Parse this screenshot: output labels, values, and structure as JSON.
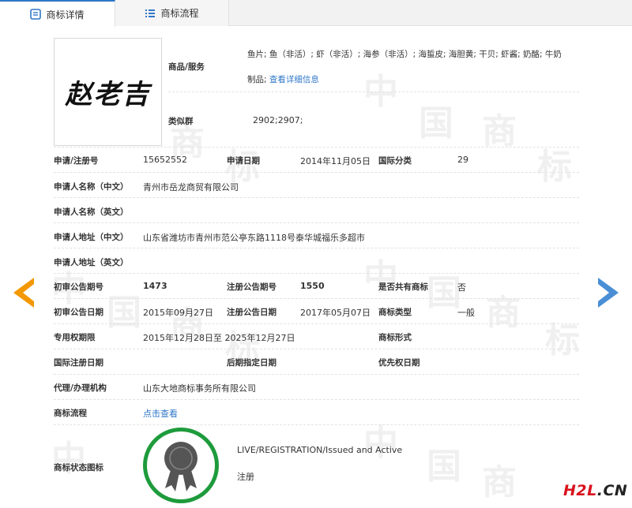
{
  "tabs": [
    {
      "label": "商标详情",
      "icon": "document-icon",
      "active": true
    },
    {
      "label": "商标流程",
      "icon": "list-icon",
      "active": false
    }
  ],
  "watermark": {
    "char1": "中",
    "char2": "国",
    "char3": "商",
    "char4": "标"
  },
  "logo": {
    "text": "赵老吉"
  },
  "goods": {
    "label": "商品/服务",
    "line1": "鱼片; 鱼（非活）; 虾（非活）; 海参（非活）; 海蜇皮; 海胆黄; 干贝; 虾酱; 奶酪; 牛奶",
    "line2": "制品;",
    "link": "查看详细信息"
  },
  "similar_group": {
    "label": "类似群",
    "value": "2902;2907;"
  },
  "fields": {
    "reg_no": {
      "label": "申请/注册号",
      "value": "15652552"
    },
    "app_date": {
      "label": "申请日期",
      "value": "2014年11月05日"
    },
    "intl_class": {
      "label": "国际分类",
      "value": "29"
    },
    "applicant_cn": {
      "label": "申请人名称（中文）",
      "value": "青州市岳龙商贸有限公司"
    },
    "applicant_en": {
      "label": "申请人名称（英文）",
      "value": ""
    },
    "address_cn": {
      "label": "申请人地址（中文）",
      "value": "山东省潍坊市青州市范公亭东路1118号泰华城福乐多超市"
    },
    "address_en": {
      "label": "申请人地址（英文）",
      "value": ""
    },
    "prelim_no": {
      "label": "初审公告期号",
      "value": "1473"
    },
    "reg_pub_no": {
      "label": "注册公告期号",
      "value": "1550"
    },
    "shared": {
      "label": "是否共有商标",
      "value": "否"
    },
    "prelim_date": {
      "label": "初审公告日期",
      "value": "2015年09月27日"
    },
    "reg_pub_date": {
      "label": "注册公告日期",
      "value": "2017年05月07日"
    },
    "tm_type": {
      "label": "商标类型",
      "value": "一般"
    },
    "exclusive_period": {
      "label": "专用权期限",
      "value": "2015年12月28日至 2025年12月27日"
    },
    "tm_form": {
      "label": "商标形式",
      "value": ""
    },
    "intl_reg_date": {
      "label": "国际注册日期",
      "value": ""
    },
    "later_date": {
      "label": "后期指定日期",
      "value": ""
    },
    "priority_date": {
      "label": "优先权日期",
      "value": ""
    },
    "agent": {
      "label": "代理/办理机构",
      "value": "山东大地商标事务所有限公司"
    },
    "flow": {
      "label": "商标流程",
      "link": "点击查看"
    },
    "status": {
      "label": "商标状态图标",
      "en": "LIVE/REGISTRATION/Issued and Active",
      "cn": "注册"
    }
  },
  "brand": {
    "part1": "H2L",
    "part2": ".CN"
  },
  "colors": {
    "accent": "#2f77c8",
    "orange": "#f39800",
    "arrow_blue": "#4a8fd6",
    "badge_green": "#1e9b3c",
    "brand_red": "#d8121d"
  }
}
